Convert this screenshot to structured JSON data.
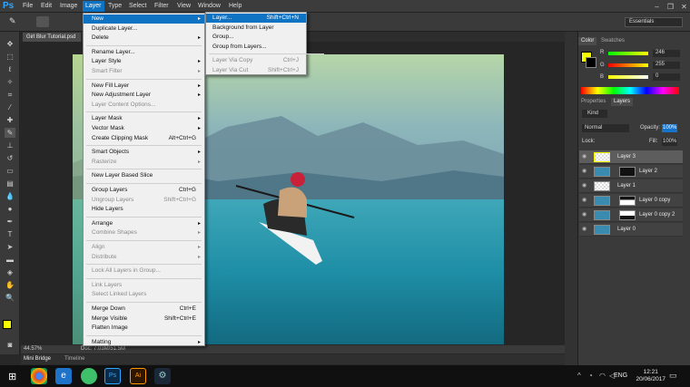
{
  "app": {
    "logo": "Ps"
  },
  "menubar": [
    "File",
    "Edit",
    "Image",
    "Layer",
    "Type",
    "Select",
    "Filter",
    "View",
    "Window",
    "Help"
  ],
  "workspace": "Essentials",
  "document": {
    "tab": "Girl Blur Tutorial.psd",
    "zoom": "44.57%",
    "doc_info": "Doc: 7.03M/51.5M"
  },
  "bottom_tabs": [
    "Mini Bridge",
    "Timeline"
  ],
  "layer_menu": [
    {
      "label": "New",
      "arrow": true,
      "highlight": true
    },
    {
      "label": "Duplicate Layer..."
    },
    {
      "label": "Delete",
      "arrow": true
    },
    {
      "sep": true
    },
    {
      "label": "Rename Layer..."
    },
    {
      "label": "Layer Style",
      "arrow": true
    },
    {
      "label": "Smart Filter",
      "arrow": true,
      "disabled": true
    },
    {
      "sep": true
    },
    {
      "label": "New Fill Layer",
      "arrow": true
    },
    {
      "label": "New Adjustment Layer",
      "arrow": true
    },
    {
      "label": "Layer Content Options...",
      "disabled": true
    },
    {
      "sep": true
    },
    {
      "label": "Layer Mask",
      "arrow": true
    },
    {
      "label": "Vector Mask",
      "arrow": true
    },
    {
      "label": "Create Clipping Mask",
      "shortcut": "Alt+Ctrl+G"
    },
    {
      "sep": true
    },
    {
      "label": "Smart Objects",
      "arrow": true
    },
    {
      "label": "Rasterize",
      "arrow": true,
      "disabled": true
    },
    {
      "sep": true
    },
    {
      "label": "New Layer Based Slice"
    },
    {
      "sep": true
    },
    {
      "label": "Group Layers",
      "shortcut": "Ctrl+G"
    },
    {
      "label": "Ungroup Layers",
      "shortcut": "Shift+Ctrl+G",
      "disabled": true
    },
    {
      "label": "Hide Layers"
    },
    {
      "sep": true
    },
    {
      "label": "Arrange",
      "arrow": true
    },
    {
      "label": "Combine Shapes",
      "arrow": true,
      "disabled": true
    },
    {
      "sep": true
    },
    {
      "label": "Align",
      "arrow": true,
      "disabled": true
    },
    {
      "label": "Distribute",
      "arrow": true,
      "disabled": true
    },
    {
      "sep": true
    },
    {
      "label": "Lock All Layers in Group...",
      "disabled": true
    },
    {
      "sep": true
    },
    {
      "label": "Link Layers",
      "disabled": true
    },
    {
      "label": "Select Linked Layers",
      "disabled": true
    },
    {
      "sep": true
    },
    {
      "label": "Merge Down",
      "shortcut": "Ctrl+E"
    },
    {
      "label": "Merge Visible",
      "shortcut": "Shift+Ctrl+E"
    },
    {
      "label": "Flatten Image"
    },
    {
      "sep": true
    },
    {
      "label": "Matting",
      "arrow": true
    }
  ],
  "new_submenu": [
    {
      "label": "Layer...",
      "shortcut": "Shift+Ctrl+N",
      "highlight": true
    },
    {
      "label": "Background from Layer"
    },
    {
      "label": "Group..."
    },
    {
      "label": "Group from Layers..."
    },
    {
      "sep": true
    },
    {
      "label": "Layer Via Copy",
      "shortcut": "Ctrl+J",
      "disabled": true
    },
    {
      "label": "Layer Via Cut",
      "shortcut": "Shift+Ctrl+J",
      "disabled": true
    }
  ],
  "color_panel": {
    "tabs": [
      "Color",
      "Swatches"
    ],
    "r_label": "R",
    "g_label": "G",
    "b_label": "B",
    "r": "246",
    "g": "255",
    "b": "0"
  },
  "layers_panel": {
    "tabs": [
      "Properties",
      "Layers"
    ],
    "kind": "Kind",
    "blend_mode": "Normal",
    "opacity_label": "Opacity:",
    "opacity": "100%",
    "lock_label": "Lock:",
    "fill_label": "Fill:",
    "fill": "100%",
    "layers": [
      "Layer 3",
      "Layer 2",
      "Layer 1",
      "Layer 0 copy",
      "Layer 0 copy 2",
      "Layer 0"
    ]
  },
  "taskbar": {
    "lang": "ENG",
    "time": "12:21",
    "date": "20/06/2017"
  },
  "colors": {
    "menu_highlight": "#0f73c4",
    "foreground": "#f6ff00"
  }
}
